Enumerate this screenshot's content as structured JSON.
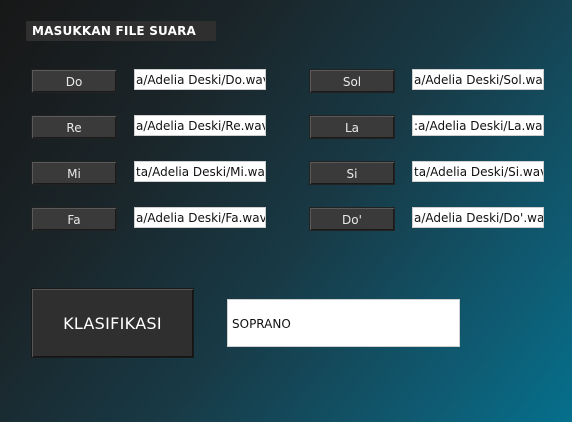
{
  "header": {
    "title": "MASUKKAN FILE SUARA"
  },
  "notes_left": [
    {
      "label": "Do",
      "path": "a/Adelia Deski/Do.wav"
    },
    {
      "label": "Re",
      "path": "a/Adelia Deski/Re.wav"
    },
    {
      "label": "Mi",
      "path": "ta/Adelia Deski/Mi.wav"
    },
    {
      "label": "Fa",
      "path": "a/Adelia Deski/Fa.wav"
    }
  ],
  "notes_right": [
    {
      "label": "Sol",
      "path": "a/Adelia Deski/Sol.wav"
    },
    {
      "label": "La",
      "path": ":a/Adelia Deski/La.wav"
    },
    {
      "label": "Si",
      "path": "ta/Adelia Deski/Si.wav"
    },
    {
      "label": "Do'",
      "path": "a/Adelia Deski/Do'.wav"
    }
  ],
  "action": {
    "classify_label": "KLASIFIKASI"
  },
  "result": {
    "value": "SOPRANO"
  }
}
